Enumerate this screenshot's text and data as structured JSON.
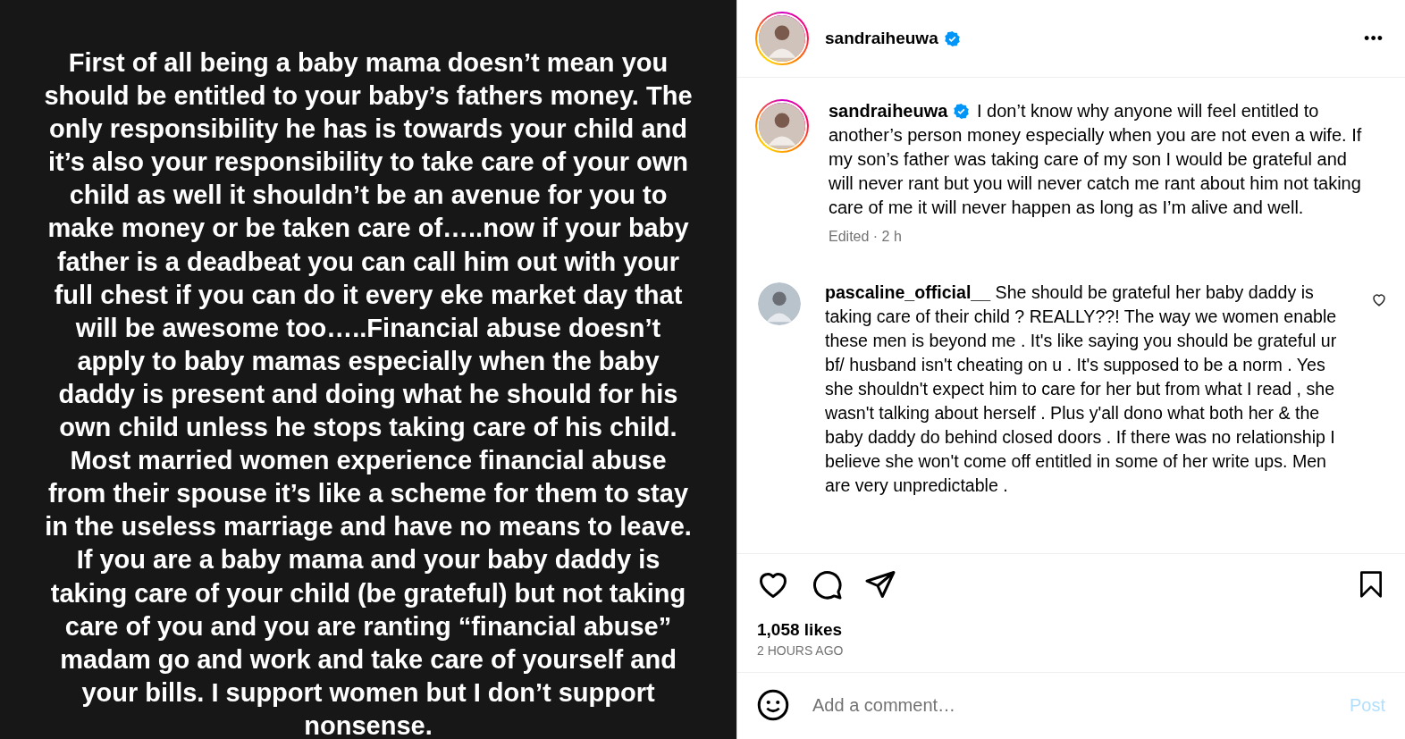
{
  "post_image": {
    "lines": [
      "First of all being a baby mama doesn’t mean you",
      "should be entitled to your baby’s fathers money. The",
      "only responsibility he has is towards your child and",
      "it’s also your responsibility to take care of your own",
      "child as well it shouldn’t be an avenue for you to",
      "make money or be taken care of…..now if your baby",
      "father is a deadbeat you can call him out with your",
      "full chest if you can do it every eke market day that",
      "will be awesome too…..Financial abuse doesn’t",
      "apply to baby mamas especially when the baby",
      "daddy is present and doing what he should for his",
      "own child unless he stops taking care of his child.",
      "Most married women experience financial abuse",
      "from their spouse it’s like a scheme for them to stay",
      "in the useless marriage and have no means to leave.",
      "If you are a baby mama and your baby daddy is",
      "taking care of your child (be grateful) but not taking",
      "care of you and you are ranting “financial abuse”",
      "madam go and work and take care of yourself and",
      "your bills. I support women but I don’t support",
      "nonsense."
    ]
  },
  "header": {
    "username": "sandraiheuwa",
    "verified": true,
    "menu": "•••"
  },
  "caption": {
    "username": "sandraiheuwa",
    "verified": true,
    "text": "I don’t know why anyone will feel entitled to another’s person money especially when you are not even a wife. If my son’s father was taking care of my son I would be grateful and will never rant but you will never catch me rant about him not taking care of me it will never happen as long as I’m alive and well.",
    "meta": "Edited · 2 h"
  },
  "comments": [
    {
      "username": "pascaline_official__",
      "text": "She should be grateful her baby daddy is taking care of their child ? REALLY??! The way we women enable these men is beyond me . It's like saying you should be grateful ur bf/ husband isn't cheating on u . It's supposed to be a norm . Yes she shouldn't expect him to care for her but from what I read , she wasn't talking about herself . Plus y'all dono what both her & the baby daddy do behind closed doors . If there was no relationship I believe she won't come off entitled in some of her write ups. Men are very unpredictable .",
      "liked": false
    }
  ],
  "actions": {
    "liked": false,
    "saved": false
  },
  "likes": "1,058 likes",
  "time": "2 HOURS AGO",
  "add_comment": {
    "placeholder": "Add a comment…",
    "post_button": "Post",
    "post_disabled": true
  }
}
